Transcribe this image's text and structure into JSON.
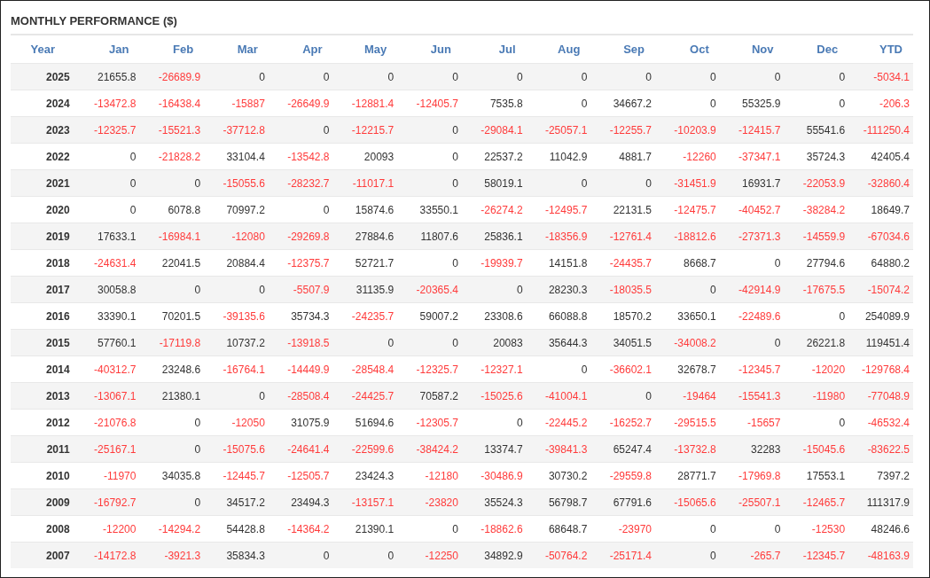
{
  "title": "MONTHLY PERFORMANCE ($)",
  "table": {
    "columns": [
      "Year",
      "Jan",
      "Feb",
      "Mar",
      "Apr",
      "May",
      "Jun",
      "Jul",
      "Aug",
      "Sep",
      "Oct",
      "Nov",
      "Dec",
      "YTD"
    ],
    "rows": [
      [
        "2025",
        "21655.8",
        "-26689.9",
        "0",
        "0",
        "0",
        "0",
        "0",
        "0",
        "0",
        "0",
        "0",
        "0",
        "-5034.1"
      ],
      [
        "2024",
        "-13472.8",
        "-16438.4",
        "-15887",
        "-26649.9",
        "-12881.4",
        "-12405.7",
        "7535.8",
        "0",
        "34667.2",
        "0",
        "55325.9",
        "0",
        "-206.3"
      ],
      [
        "2023",
        "-12325.7",
        "-15521.3",
        "-37712.8",
        "0",
        "-12215.7",
        "0",
        "-29084.1",
        "-25057.1",
        "-12255.7",
        "-10203.9",
        "-12415.7",
        "55541.6",
        "-111250.4"
      ],
      [
        "2022",
        "0",
        "-21828.2",
        "33104.4",
        "-13542.8",
        "20093",
        "0",
        "22537.2",
        "11042.9",
        "4881.7",
        "-12260",
        "-37347.1",
        "35724.3",
        "42405.4"
      ],
      [
        "2021",
        "0",
        "0",
        "-15055.6",
        "-28232.7",
        "-11017.1",
        "0",
        "58019.1",
        "0",
        "0",
        "-31451.9",
        "16931.7",
        "-22053.9",
        "-32860.4"
      ],
      [
        "2020",
        "0",
        "6078.8",
        "70997.2",
        "0",
        "15874.6",
        "33550.1",
        "-26274.2",
        "-12495.7",
        "22131.5",
        "-12475.7",
        "-40452.7",
        "-38284.2",
        "18649.7"
      ],
      [
        "2019",
        "17633.1",
        "-16984.1",
        "-12080",
        "-29269.8",
        "27884.6",
        "11807.6",
        "25836.1",
        "-18356.9",
        "-12761.4",
        "-18812.6",
        "-27371.3",
        "-14559.9",
        "-67034.6"
      ],
      [
        "2018",
        "-24631.4",
        "22041.5",
        "20884.4",
        "-12375.7",
        "52721.7",
        "0",
        "-19939.7",
        "14151.8",
        "-24435.7",
        "8668.7",
        "0",
        "27794.6",
        "64880.2"
      ],
      [
        "2017",
        "30058.8",
        "0",
        "0",
        "-5507.9",
        "31135.9",
        "-20365.4",
        "0",
        "28230.3",
        "-18035.5",
        "0",
        "-42914.9",
        "-17675.5",
        "-15074.2"
      ],
      [
        "2016",
        "33390.1",
        "70201.5",
        "-39135.6",
        "35734.3",
        "-24235.7",
        "59007.2",
        "23308.6",
        "66088.8",
        "18570.2",
        "33650.1",
        "-22489.6",
        "0",
        "254089.9"
      ],
      [
        "2015",
        "57760.1",
        "-17119.8",
        "10737.2",
        "-13918.5",
        "0",
        "0",
        "20083",
        "35644.3",
        "34051.5",
        "-34008.2",
        "0",
        "26221.8",
        "119451.4"
      ],
      [
        "2014",
        "-40312.7",
        "23248.6",
        "-16764.1",
        "-14449.9",
        "-28548.4",
        "-12325.7",
        "-12327.1",
        "0",
        "-36602.1",
        "32678.7",
        "-12345.7",
        "-12020",
        "-129768.4"
      ],
      [
        "2013",
        "-13067.1",
        "21380.1",
        "0",
        "-28508.4",
        "-24425.7",
        "70587.2",
        "-15025.6",
        "-41004.1",
        "0",
        "-19464",
        "-15541.3",
        "-11980",
        "-77048.9"
      ],
      [
        "2012",
        "-21076.8",
        "0",
        "-12050",
        "31075.9",
        "51694.6",
        "-12305.7",
        "0",
        "-22445.2",
        "-16252.7",
        "-29515.5",
        "-15657",
        "0",
        "-46532.4"
      ],
      [
        "2011",
        "-25167.1",
        "0",
        "-15075.6",
        "-24641.4",
        "-22599.6",
        "-38424.2",
        "13374.7",
        "-39841.3",
        "65247.4",
        "-13732.8",
        "32283",
        "-15045.6",
        "-83622.5"
      ],
      [
        "2010",
        "-11970",
        "34035.8",
        "-12445.7",
        "-12505.7",
        "23424.3",
        "-12180",
        "-30486.9",
        "30730.2",
        "-29559.8",
        "28771.7",
        "-17969.8",
        "17553.1",
        "7397.2"
      ],
      [
        "2009",
        "-16792.7",
        "0",
        "34517.2",
        "23494.3",
        "-13157.1",
        "-23820",
        "35524.3",
        "56798.7",
        "67791.6",
        "-15065.6",
        "-25507.1",
        "-12465.7",
        "111317.9"
      ],
      [
        "2008",
        "-12200",
        "-14294.2",
        "54428.8",
        "-14364.2",
        "21390.1",
        "0",
        "-18862.6",
        "68648.7",
        "-23970",
        "0",
        "0",
        "-12530",
        "48246.6"
      ],
      [
        "2007",
        "-14172.8",
        "-3921.3",
        "35834.3",
        "0",
        "0",
        "-12250",
        "34892.9",
        "-50764.2",
        "-25171.4",
        "0",
        "-265.7",
        "-12345.7",
        "-48163.9"
      ]
    ]
  }
}
